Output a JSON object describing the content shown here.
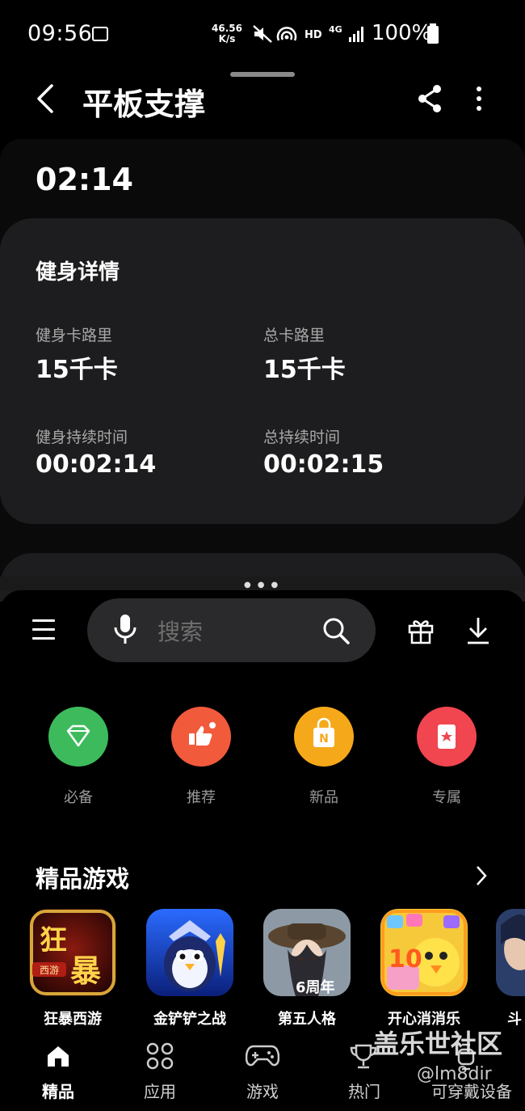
{
  "status_bar": {
    "time": "09:56",
    "net_speed_value": "46.56",
    "net_speed_unit": "K/s",
    "hd": "HD",
    "network": "4G",
    "battery": "100%"
  },
  "header": {
    "title": "平板支撑"
  },
  "workout": {
    "elapsed": "02:14",
    "details_title": "健身详情",
    "stats": [
      {
        "label": "健身卡路里",
        "value": "15千卡"
      },
      {
        "label": "总卡路里",
        "value": "15千卡"
      },
      {
        "label": "健身持续时间",
        "value": "00:02:14"
      },
      {
        "label": "总持续时间",
        "value": "00:02:15"
      }
    ]
  },
  "store": {
    "search_placeholder": "搜索",
    "categories": [
      {
        "label": "必备",
        "color": "#3dbb5c"
      },
      {
        "label": "推荐",
        "color": "#f25a3c"
      },
      {
        "label": "新品",
        "color": "#f5a91a"
      },
      {
        "label": "专属",
        "color": "#f1454f"
      }
    ],
    "section_title": "精品游戏",
    "games": [
      {
        "name": "狂暴西游",
        "badge": "狂",
        "badge2": "暴",
        "sub": "西游"
      },
      {
        "name": "金铲铲之战"
      },
      {
        "name": "第五人格",
        "badge": "6周年"
      },
      {
        "name": "开心消消乐",
        "badge": "10"
      },
      {
        "name": "斗"
      }
    ],
    "nav": [
      {
        "label": "精品",
        "active": true
      },
      {
        "label": "应用"
      },
      {
        "label": "游戏"
      },
      {
        "label": "热门"
      },
      {
        "label": "可穿戴设备"
      }
    ]
  },
  "watermark": {
    "line1": "盖乐世社区",
    "line2": "@lm8dir"
  }
}
